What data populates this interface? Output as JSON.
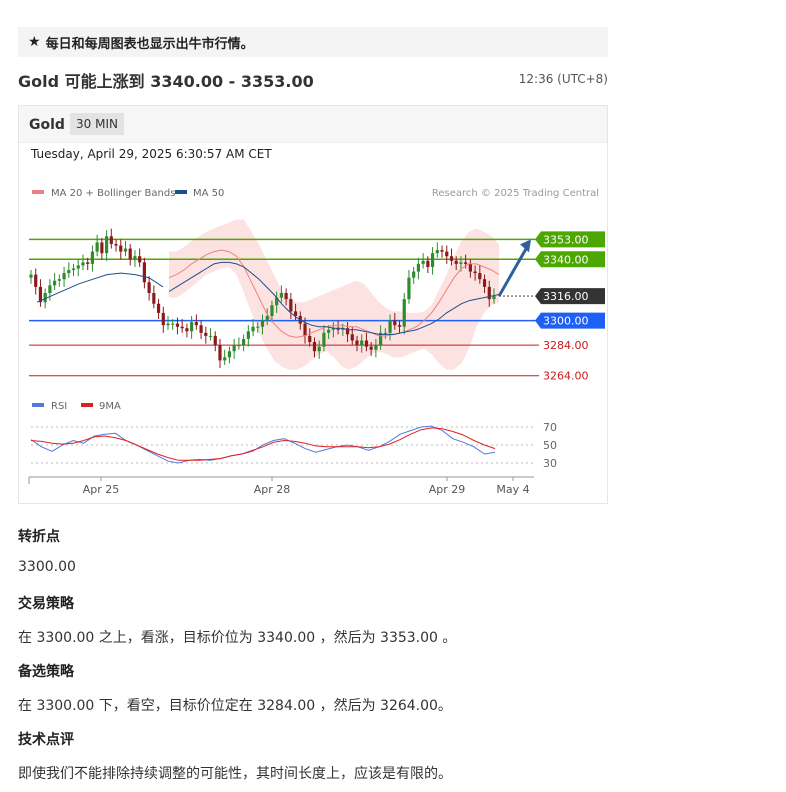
{
  "banner": {
    "icon": "star-icon",
    "text": "每日和每周图表也显示出牛市行情。"
  },
  "headline": "Gold 可能上涨到 3340.00 - 3353.00",
  "timestamp": "12:36 (UTC+8)",
  "chart_card": {
    "symbol": "Gold",
    "timeframe": "30 MIN",
    "date": "Tuesday, April 29, 2025 6:30:57 AM CET",
    "legend": [
      {
        "label": "MA 20 + Bollinger Bands",
        "color": "#f08080"
      },
      {
        "label": "MA 50",
        "color": "#1f4e8c"
      }
    ],
    "credit": "Research © 2025 Trading Central",
    "rsi_legend": [
      {
        "label": "RSI",
        "color": "#4f7ae0"
      },
      {
        "label": "9MA",
        "color": "#e02020"
      }
    ]
  },
  "colors": {
    "up_candle": "#2e8b2e",
    "down_candle": "#8b1a1a",
    "resistance": "#4ca800",
    "pivot": "#1e5ff5",
    "support": "#cc1a1a",
    "current": "#333333",
    "band_fill": "#fde2e2",
    "arrow": "#2f5f9e"
  },
  "chart_data": {
    "type": "candlestick",
    "x_ticks": [
      "Apr 25",
      "Apr 28",
      "Apr 29",
      "May 4"
    ],
    "ylim": [
      3256,
      3380
    ],
    "levels": [
      {
        "label": "3353.00",
        "value": 3353,
        "kind": "resistance"
      },
      {
        "label": "3340.00",
        "value": 3340,
        "kind": "resistance"
      },
      {
        "label": "3316.00",
        "value": 3316,
        "kind": "current"
      },
      {
        "label": "3300.00",
        "value": 3300,
        "kind": "pivot"
      },
      {
        "label": "3284.00",
        "value": 3284,
        "kind": "support"
      },
      {
        "label": "3264.00",
        "value": 3264,
        "kind": "support"
      }
    ],
    "closes": [
      3330,
      3322,
      3312,
      3318,
      3323,
      3326,
      3327,
      3331,
      3333,
      3334,
      3336,
      3338,
      3337,
      3345,
      3351,
      3344,
      3355,
      3350,
      3349,
      3345,
      3347,
      3340,
      3342,
      3338,
      3325,
      3318,
      3311,
      3305,
      3297,
      3298,
      3298,
      3296,
      3295,
      3293,
      3299,
      3297,
      3292,
      3290,
      3290,
      3284,
      3274,
      3276,
      3280,
      3284,
      3284,
      3288,
      3293,
      3296,
      3296,
      3300,
      3303,
      3310,
      3315,
      3318,
      3314,
      3306,
      3303,
      3298,
      3290,
      3286,
      3280,
      3283,
      3292,
      3294,
      3295,
      3294,
      3295,
      3291,
      3287,
      3284,
      3287,
      3283,
      3281,
      3284,
      3292,
      3292,
      3300,
      3297,
      3296,
      3314,
      3328,
      3332,
      3337,
      3339,
      3335,
      3344,
      3346,
      3345,
      3342,
      3339,
      3337,
      3338,
      3337,
      3332,
      3331,
      3327,
      3322,
      3314,
      3316
    ],
    "bollinger_upper": [
      3345,
      3345,
      3348,
      3352,
      3355,
      3358,
      3360,
      3362,
      3364,
      3366,
      3366,
      3358,
      3350,
      3340,
      3330,
      3320,
      3315,
      3312,
      3312,
      3314,
      3316,
      3318,
      3320,
      3322,
      3324,
      3326,
      3324,
      3318,
      3312,
      3308,
      3306,
      3306,
      3305,
      3305,
      3306,
      3310,
      3320,
      3330,
      3342,
      3352,
      3358,
      3360,
      3358,
      3355,
      3350
    ],
    "bollinger_lower": [
      3315,
      3315,
      3318,
      3322,
      3326,
      3330,
      3332,
      3334,
      3335,
      3330,
      3318,
      3305,
      3292,
      3282,
      3274,
      3270,
      3268,
      3268,
      3270,
      3274,
      3278,
      3280,
      3276,
      3270,
      3268,
      3270,
      3274,
      3278,
      3280,
      3278,
      3276,
      3276,
      3278,
      3280,
      3282,
      3278,
      3272,
      3268,
      3268,
      3272,
      3282,
      3296,
      3305,
      3310,
      3312
    ],
    "ma20": [
      3328,
      3330,
      3333,
      3337,
      3340,
      3343,
      3345,
      3346,
      3345,
      3342,
      3335,
      3325,
      3315,
      3305,
      3298,
      3293,
      3290,
      3289,
      3290,
      3292,
      3294,
      3296,
      3297,
      3297,
      3296,
      3296,
      3294,
      3292,
      3290,
      3290,
      3291,
      3292,
      3294,
      3296,
      3300,
      3305,
      3312,
      3320,
      3328,
      3334,
      3337,
      3337,
      3335,
      3333,
      3330
    ],
    "ma50": [
      3319,
      3322,
      3325,
      3328,
      3331,
      3334,
      3337,
      3338,
      3338,
      3337,
      3335,
      3331,
      3327,
      3322,
      3317,
      3311,
      3306,
      3302,
      3299,
      3297,
      3296,
      3296,
      3295,
      3295,
      3294,
      3294,
      3293,
      3292,
      3291,
      3291,
      3291,
      3292,
      3293,
      3294,
      3296,
      3298,
      3301,
      3305,
      3308,
      3311,
      3313,
      3314,
      3315,
      3316,
      3317
    ],
    "target": 3353,
    "rsi": {
      "ylim": [
        20,
        80
      ],
      "levels": [
        70,
        50,
        30
      ],
      "rsi": [
        56,
        48,
        43,
        50,
        55,
        52,
        60,
        62,
        63,
        55,
        50,
        44,
        38,
        32,
        30,
        33,
        34,
        33,
        35,
        38,
        40,
        43,
        50,
        55,
        57,
        52,
        46,
        42,
        45,
        48,
        50,
        48,
        44,
        48,
        54,
        62,
        66,
        70,
        71,
        66,
        57,
        53,
        48,
        40,
        42
      ],
      "ma": [
        55,
        54,
        52,
        51,
        52,
        55,
        59,
        60,
        58,
        55,
        50,
        45,
        40,
        36,
        33,
        33,
        33,
        34,
        35,
        38,
        40,
        44,
        48,
        53,
        55,
        54,
        52,
        49,
        48,
        48,
        48,
        48,
        47,
        48,
        51,
        56,
        62,
        67,
        69,
        68,
        65,
        61,
        55,
        50,
        46
      ]
    }
  },
  "sections": [
    {
      "title": "转折点",
      "text": "3300.00"
    },
    {
      "title": "交易策略",
      "text": "在 3300.00 之上，看涨，目标价位为 3340.00 ，然后为 3353.00 。"
    },
    {
      "title": "备选策略",
      "text": "在 3300.00 下，看空，目标价位定在 3284.00 ，然后为 3264.00。"
    },
    {
      "title": "技术点评",
      "text": "即使我们不能排除持续调整的可能性，其时间长度上，应该是有限的。"
    }
  ]
}
